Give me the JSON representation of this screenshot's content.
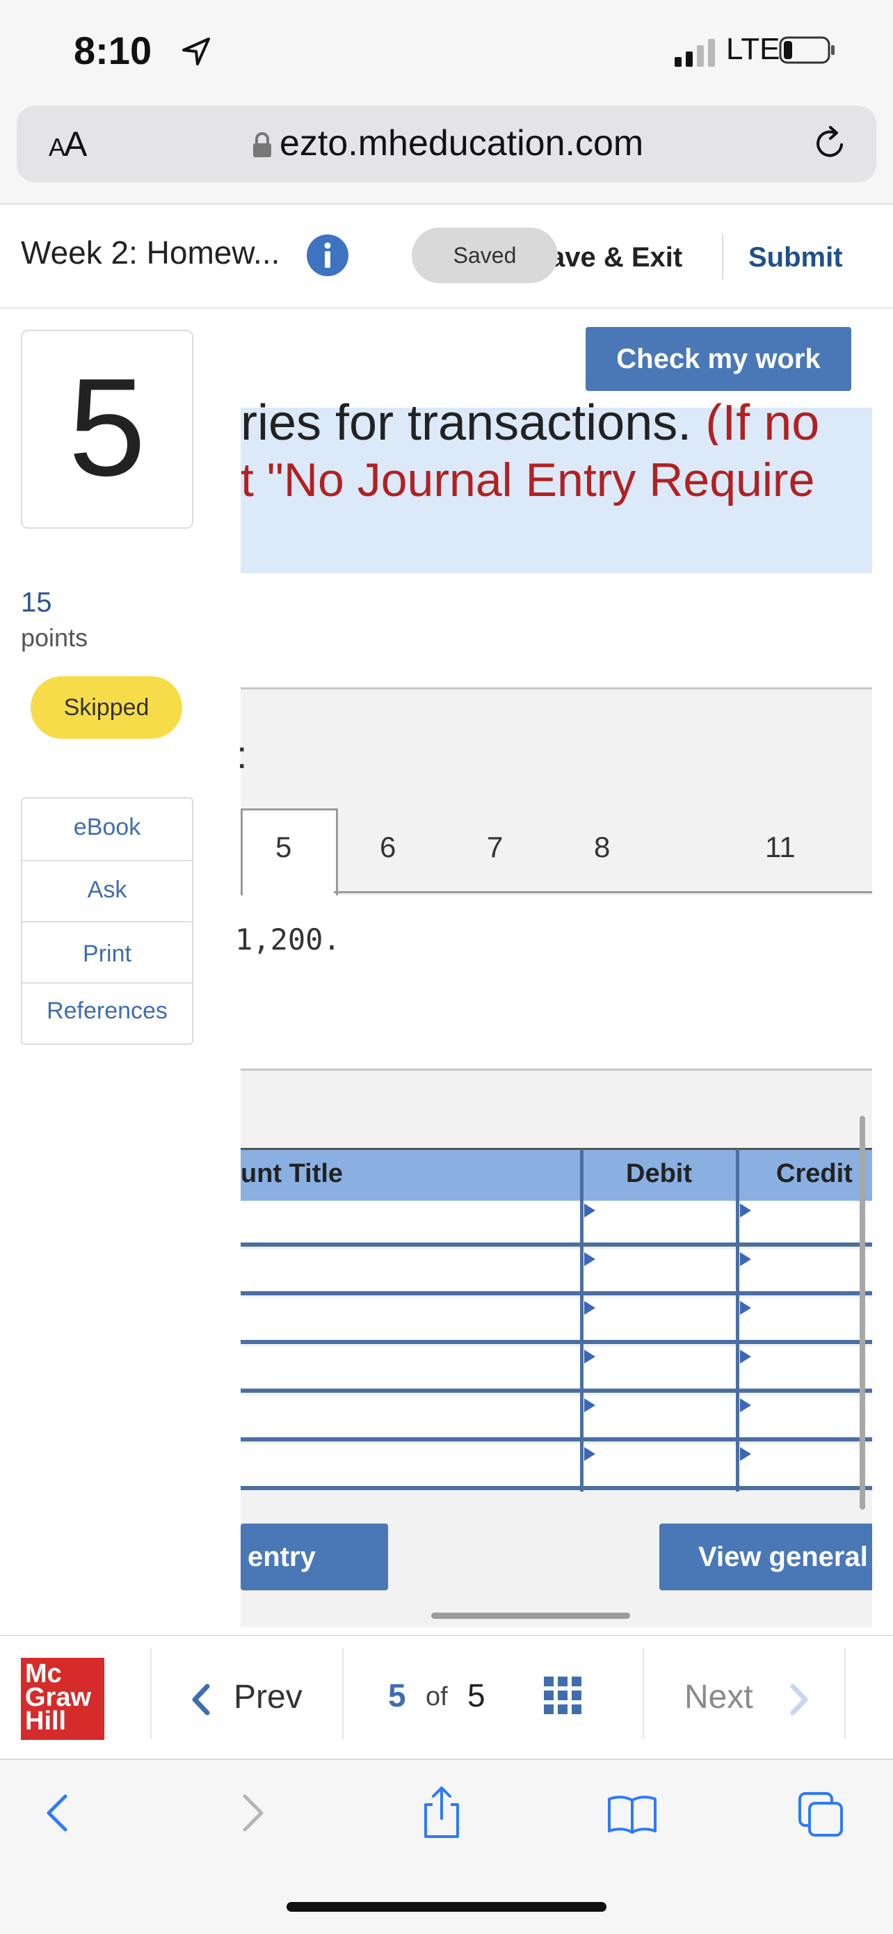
{
  "status_bar": {
    "time": "8:10",
    "network": "LTE"
  },
  "browser": {
    "text_size_label_small": "A",
    "text_size_label_large": "A",
    "url": "ezto.mheducation.com"
  },
  "assignment_header": {
    "title": "Week 2: Homew...",
    "saved_label": "Saved",
    "save_exit_label": "ave & Exit",
    "submit_label": "Submit"
  },
  "question": {
    "number": "5",
    "points_value": "15",
    "points_label": "points",
    "status": "Skipped",
    "tools": [
      "eBook",
      "Ask",
      "Print",
      "References"
    ],
    "check_label": "Check my work",
    "prompt_visible": "ries for transactions.",
    "prompt_red_1": "(If no",
    "prompt_red_2": "t \"No Journal Entry Require",
    "tabs_colon": ":",
    "tabs": [
      "5",
      "6",
      "7",
      "8",
      "11"
    ],
    "amount_text": "1,200."
  },
  "journal": {
    "columns": [
      "unt Title",
      "Debit",
      "Credit"
    ],
    "row_count": 6,
    "record_label": "entry",
    "view_label": "View general j"
  },
  "page_nav": {
    "logo_lines": [
      "Mc",
      "Graw",
      "Hill"
    ],
    "prev_label": "Prev",
    "current_page": "5",
    "of_label": "of",
    "total_pages": "5",
    "next_label": "Next"
  }
}
